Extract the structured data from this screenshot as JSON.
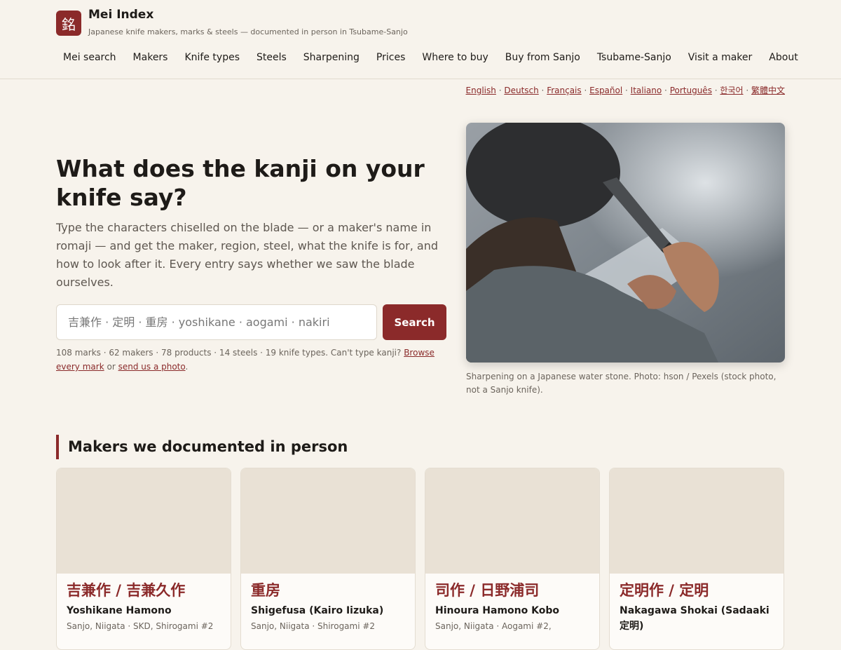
{
  "brand": {
    "logo_char": "銘",
    "title": "Mei Index",
    "subtitle": "Japanese knife makers, marks & steels — documented in person in Tsubame-Sanjo"
  },
  "nav": [
    "Mei search",
    "Makers",
    "Knife types",
    "Steels",
    "Sharpening",
    "Prices",
    "Where to buy",
    "Buy from Sanjo",
    "Tsubame-Sanjo",
    "Visit a maker",
    "About"
  ],
  "languages": [
    "English",
    "Deutsch",
    "Français",
    "Español",
    "Italiano",
    "Português",
    "한국어",
    "繁體中文"
  ],
  "hero": {
    "title": "What does the kanji on your knife say?",
    "description": "Type the characters chiselled on the blade — or a maker's name in romaji — and get the maker, region, steel, what the knife is for, and how to look after it. Every entry says whether we saw the blade ourselves.",
    "search_placeholder": "吉兼作 · 定明 · 重房 · yoshikane · aogami · nakiri",
    "search_button": "Search",
    "stats_text": "108 marks · 62 makers · 78 products · 14 steels · 19 knife types. Can't type kanji?",
    "browse_link": "Browse every mark",
    "or_text": "or",
    "photo_link": "send us a photo",
    "period": "."
  },
  "image_caption": "Sharpening on a Japanese water stone. Photo: hson / Pexels (stock photo, not a Sanjo knife).",
  "section_title": "Makers we documented in person",
  "makers": [
    {
      "mark": "吉兼作 / 吉兼久作",
      "name": "Yoshikane Hamono",
      "meta": "Sanjo, Niigata · SKD, Shirogami #2"
    },
    {
      "mark": "重房",
      "name": "Shigefusa (Kairo Iizuka)",
      "meta": "Sanjo, Niigata · Shirogami #2"
    },
    {
      "mark": "司作 / 日野浦司",
      "name": "Hinoura Hamono Kobo",
      "meta": "Sanjo, Niigata · Aogami #2,"
    },
    {
      "mark": "定明作 / 定明",
      "name": "Nakagawa Shokai (Sadaaki 定明)",
      "meta": ""
    }
  ]
}
